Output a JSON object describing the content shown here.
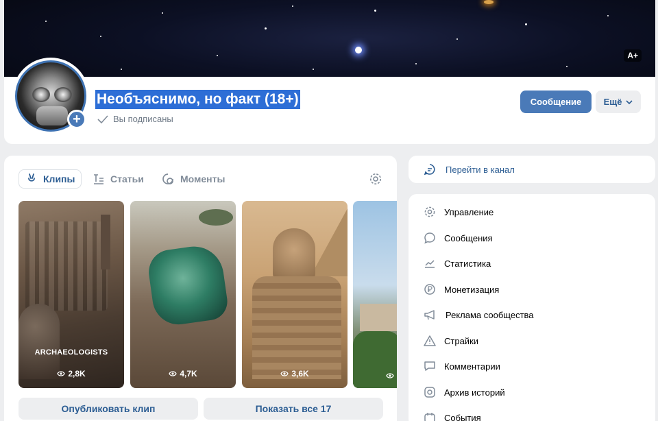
{
  "cover": {
    "badge": "A+"
  },
  "header": {
    "title": "Необъяснимо, но факт (18+)",
    "subscribed_label": "Вы подписаны",
    "message_button": "Сообщение",
    "more_button": "Ещё"
  },
  "clips": {
    "tabs": [
      {
        "label": "Клипы",
        "icon": "clips-icon",
        "active": true
      },
      {
        "label": "Статьи",
        "icon": "articles-icon",
        "active": false
      },
      {
        "label": "Моменты",
        "icon": "moments-icon",
        "active": false
      }
    ],
    "items": [
      {
        "caption": "ARCHAEOLOGISTS",
        "views": "2,8K"
      },
      {
        "caption": "",
        "views": "4,7K"
      },
      {
        "caption": "",
        "views": "3,6K"
      },
      {
        "caption": "",
        "views": ""
      }
    ],
    "publish_button": "Опубликовать клип",
    "show_all_button": "Показать все 17"
  },
  "channel": {
    "label": "Перейти в канал"
  },
  "menu": {
    "items": [
      {
        "label": "Управление",
        "icon": "gear-icon"
      },
      {
        "label": "Сообщения",
        "icon": "message-icon"
      },
      {
        "label": "Статистика",
        "icon": "chart-icon"
      },
      {
        "label": "Монетизация",
        "icon": "ruble-icon"
      },
      {
        "label": "Реклама сообщества",
        "icon": "megaphone-icon"
      },
      {
        "label": "Страйки",
        "icon": "warning-icon"
      },
      {
        "label": "Комментарии",
        "icon": "comment-icon"
      },
      {
        "label": "Архив историй",
        "icon": "stories-archive-icon"
      },
      {
        "label": "События",
        "icon": "events-icon"
      }
    ]
  },
  "colors": {
    "accent": "#4a7ab8",
    "link": "#2c5d93",
    "title_highlight": "#2d6ed6",
    "page_bg": "#edeef0"
  }
}
